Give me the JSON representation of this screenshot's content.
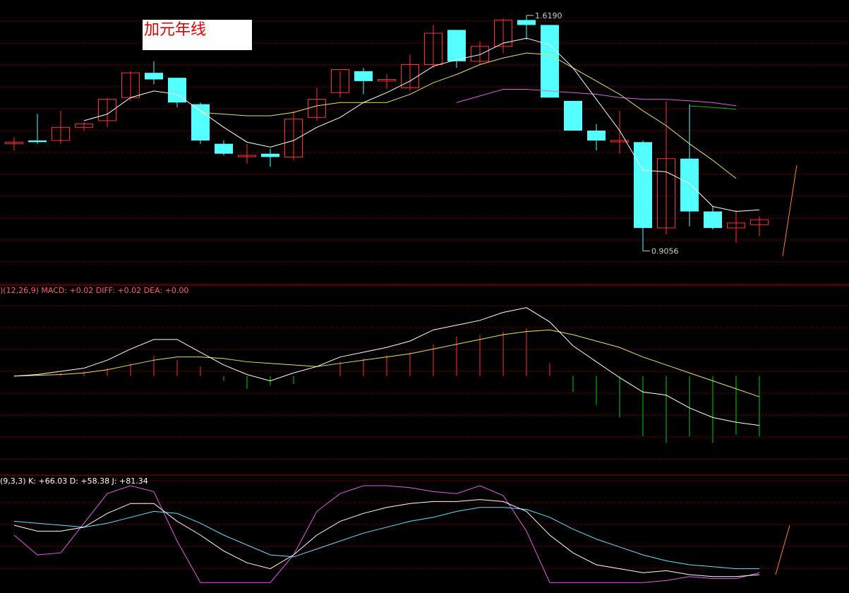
{
  "title": "加元年线",
  "colors": {
    "background": "#000000",
    "grid": "#7a0000",
    "separator": "#a00000",
    "candle_up": "#ff3030",
    "candle_down": "#54ffff",
    "ma_white": "#ffffff",
    "ma_yellow": "#e8e060",
    "ma_purple": "#e060e0",
    "ma_green": "#00c000",
    "macd_pos": "#ff3030",
    "macd_neg": "#00d000",
    "diff": "#ffffff",
    "dea": "#e8e060",
    "kdj_k": "#ffffff",
    "kdj_d": "#66e0ff",
    "kdj_j": "#e060e0",
    "forecast": "#ff8030"
  },
  "chart_data": [
    {
      "type": "candlestick",
      "title": "加元年线",
      "ylim": [
        0.87,
        1.64
      ],
      "annotations": {
        "high_label": "1.6190",
        "low_label": "0.9056"
      },
      "candles": [
        {
          "o": 1.23,
          "h": 1.25,
          "l": 1.21,
          "c": 1.235
        },
        {
          "o": 1.24,
          "h": 1.32,
          "l": 1.23,
          "c": 1.235
        },
        {
          "o": 1.24,
          "h": 1.33,
          "l": 1.23,
          "c": 1.28
        },
        {
          "o": 1.28,
          "h": 1.295,
          "l": 1.27,
          "c": 1.29
        },
        {
          "o": 1.3,
          "h": 1.37,
          "l": 1.28,
          "c": 1.365
        },
        {
          "o": 1.37,
          "h": 1.45,
          "l": 1.36,
          "c": 1.445
        },
        {
          "o": 1.445,
          "h": 1.48,
          "l": 1.41,
          "c": 1.425
        },
        {
          "o": 1.43,
          "h": 1.43,
          "l": 1.34,
          "c": 1.355
        },
        {
          "o": 1.35,
          "h": 1.355,
          "l": 1.23,
          "c": 1.24
        },
        {
          "o": 1.23,
          "h": 1.24,
          "l": 1.195,
          "c": 1.2
        },
        {
          "o": 1.195,
          "h": 1.23,
          "l": 1.17,
          "c": 1.195
        },
        {
          "o": 1.2,
          "h": 1.215,
          "l": 1.16,
          "c": 1.19
        },
        {
          "o": 1.19,
          "h": 1.33,
          "l": 1.18,
          "c": 1.305
        },
        {
          "o": 1.31,
          "h": 1.4,
          "l": 1.3,
          "c": 1.365
        },
        {
          "o": 1.385,
          "h": 1.45,
          "l": 1.37,
          "c": 1.455
        },
        {
          "o": 1.45,
          "h": 1.46,
          "l": 1.38,
          "c": 1.42
        },
        {
          "o": 1.42,
          "h": 1.44,
          "l": 1.395,
          "c": 1.425
        },
        {
          "o": 1.4,
          "h": 1.5,
          "l": 1.39,
          "c": 1.47
        },
        {
          "o": 1.47,
          "h": 1.59,
          "l": 1.46,
          "c": 1.565
        },
        {
          "o": 1.575,
          "h": 1.575,
          "l": 1.46,
          "c": 1.48
        },
        {
          "o": 1.48,
          "h": 1.54,
          "l": 1.47,
          "c": 1.525
        },
        {
          "o": 1.525,
          "h": 1.61,
          "l": 1.505,
          "c": 1.605
        },
        {
          "o": 1.605,
          "h": 1.619,
          "l": 1.545,
          "c": 1.59
        },
        {
          "o": 1.59,
          "h": 1.59,
          "l": 1.37,
          "c": 1.37
        },
        {
          "o": 1.36,
          "h": 1.36,
          "l": 1.27,
          "c": 1.27
        },
        {
          "o": 1.27,
          "h": 1.29,
          "l": 1.21,
          "c": 1.24
        },
        {
          "o": 1.24,
          "h": 1.33,
          "l": 1.2,
          "c": 1.24
        },
        {
          "o": 1.235,
          "h": 1.24,
          "l": 0.9056,
          "c": 0.975
        },
        {
          "o": 0.975,
          "h": 1.36,
          "l": 0.955,
          "c": 1.185
        },
        {
          "o": 1.185,
          "h": 1.35,
          "l": 0.98,
          "c": 1.025
        },
        {
          "o": 1.025,
          "h": 1.04,
          "l": 0.97,
          "c": 0.975
        },
        {
          "o": 0.975,
          "h": 1.03,
          "l": 0.93,
          "c": 0.99
        },
        {
          "o": 0.985,
          "h": 1.01,
          "l": 0.95,
          "c": 1.0
        }
      ],
      "ma_white": [
        null,
        null,
        null,
        1.3,
        1.32,
        1.37,
        1.39,
        1.38,
        1.33,
        1.28,
        1.235,
        1.22,
        1.24,
        1.28,
        1.31,
        1.355,
        1.385,
        1.42,
        1.465,
        1.485,
        1.5,
        1.535,
        1.55,
        1.53,
        1.46,
        1.365,
        1.27,
        1.15,
        1.145,
        1.11,
        1.04,
        1.025,
        1.03
      ],
      "ma_yellow": [
        null,
        null,
        null,
        null,
        null,
        null,
        null,
        null,
        1.325,
        1.32,
        1.315,
        1.315,
        1.325,
        1.345,
        1.355,
        1.355,
        1.355,
        1.38,
        1.415,
        1.44,
        1.47,
        1.49,
        1.505,
        1.5,
        1.46,
        1.42,
        1.38,
        1.33,
        1.285,
        1.23,
        1.18,
        1.125,
        null
      ],
      "ma_purple": [
        null,
        null,
        null,
        null,
        null,
        null,
        null,
        null,
        null,
        null,
        null,
        null,
        null,
        null,
        null,
        null,
        null,
        null,
        null,
        1.355,
        1.375,
        1.395,
        1.395,
        1.39,
        1.385,
        1.38,
        1.37,
        1.365,
        1.365,
        1.36,
        1.355,
        1.345,
        null
      ],
      "ma_green": [
        null,
        null,
        null,
        null,
        null,
        null,
        null,
        null,
        null,
        null,
        null,
        null,
        null,
        null,
        null,
        null,
        null,
        null,
        null,
        null,
        null,
        null,
        null,
        null,
        null,
        null,
        null,
        null,
        null,
        1.345,
        1.34,
        1.335,
        null
      ],
      "forecast": {
        "from": 0.89,
        "to": 1.165
      }
    },
    {
      "type": "line",
      "header": ")(12,26,9) MACD: +0.02 DIFF: +0.02 DEA: +0.00",
      "ylim": [
        -0.12,
        0.1
      ],
      "macd": [
        null,
        0.002,
        0.004,
        0.006,
        0.01,
        0.016,
        0.026,
        0.02,
        0.012,
        -0.006,
        -0.016,
        -0.012,
        -0.01,
        0.0,
        0.018,
        0.022,
        0.026,
        0.03,
        0.04,
        0.05,
        0.052,
        0.056,
        0.06,
        0.016,
        -0.02,
        -0.036,
        -0.052,
        -0.076,
        -0.084,
        -0.076,
        -0.084,
        -0.074,
        -0.076
      ],
      "diff": [
        0.0,
        0.002,
        0.006,
        0.01,
        0.02,
        0.034,
        0.046,
        0.046,
        0.03,
        0.014,
        0.002,
        -0.006,
        0.004,
        0.012,
        0.024,
        0.03,
        0.036,
        0.044,
        0.058,
        0.064,
        0.07,
        0.08,
        0.086,
        0.068,
        0.038,
        0.018,
        -0.002,
        -0.02,
        -0.024,
        -0.04,
        -0.052,
        -0.058,
        -0.062
      ],
      "dea": [
        0.0,
        0.001,
        0.002,
        0.004,
        0.008,
        0.014,
        0.02,
        0.024,
        0.024,
        0.022,
        0.018,
        0.016,
        0.014,
        0.012,
        0.016,
        0.02,
        0.024,
        0.028,
        0.034,
        0.04,
        0.046,
        0.052,
        0.056,
        0.058,
        0.052,
        0.044,
        0.036,
        0.024,
        0.014,
        0.004,
        -0.006,
        -0.016,
        -0.026
      ]
    },
    {
      "type": "line",
      "header": "(9,3,3) K: +66.03 D: +58.38 J: +81.34",
      "ylim": [
        0,
        100
      ],
      "K": [
        60,
        54,
        54,
        58,
        72,
        82,
        82,
        64,
        50,
        34,
        22,
        16,
        30,
        50,
        64,
        72,
        78,
        82,
        84,
        84,
        86,
        84,
        74,
        50,
        32,
        20,
        16,
        12,
        14,
        10,
        8,
        8,
        10
      ],
      "D": [
        64,
        62,
        60,
        58,
        62,
        68,
        74,
        72,
        62,
        50,
        40,
        30,
        28,
        36,
        44,
        52,
        58,
        64,
        68,
        74,
        78,
        78,
        76,
        68,
        56,
        46,
        38,
        30,
        24,
        20,
        18,
        16,
        16
      ],
      "J": [
        50,
        30,
        32,
        62,
        92,
        100,
        94,
        44,
        2,
        2,
        2,
        2,
        30,
        74,
        92,
        100,
        100,
        98,
        94,
        92,
        100,
        90,
        54,
        2,
        2,
        2,
        2,
        2,
        4,
        8,
        6,
        6,
        12
      ],
      "forecast": {
        "from": 10,
        "to": 60
      }
    }
  ]
}
